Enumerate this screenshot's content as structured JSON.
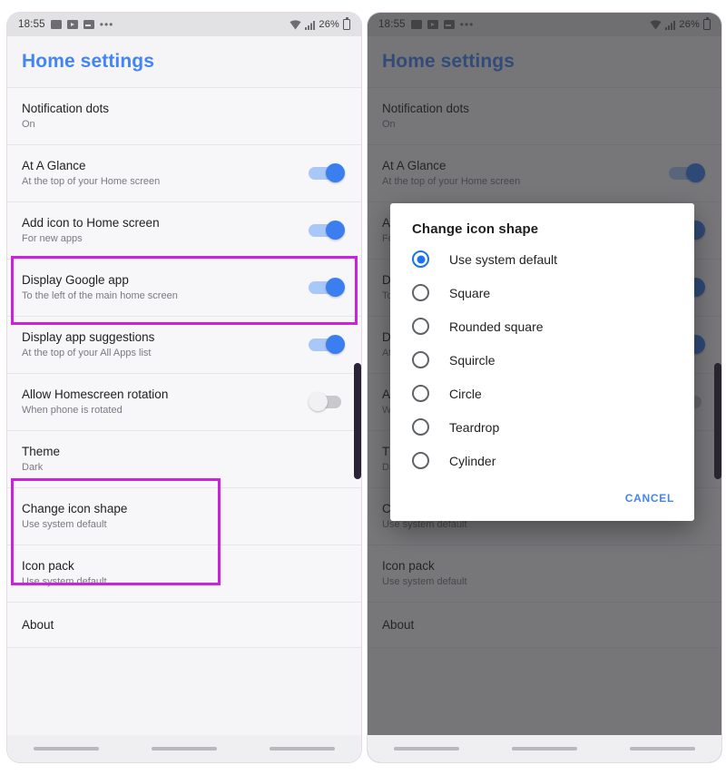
{
  "status_bar": {
    "time": "18:55",
    "battery_percent": "26%",
    "icons": [
      "photo-icon",
      "video-icon",
      "card-icon",
      "overflow-dots-icon",
      "wifi-icon",
      "signal-icon",
      "battery-icon"
    ]
  },
  "header": {
    "title": "Home settings"
  },
  "settings": [
    {
      "title": "Notification dots",
      "subtitle": "On",
      "control": "none",
      "state": ""
    },
    {
      "title": "At A Glance",
      "subtitle": "At the top of your Home screen",
      "control": "switch",
      "state": "on"
    },
    {
      "title": "Add icon to Home screen",
      "subtitle": "For new apps",
      "control": "switch",
      "state": "on"
    },
    {
      "title": "Display Google app",
      "subtitle": "To the left of the main home screen",
      "control": "switch",
      "state": "on"
    },
    {
      "title": "Display app suggestions",
      "subtitle": "At the top of your All Apps list",
      "control": "switch",
      "state": "on"
    },
    {
      "title": "Allow Homescreen rotation",
      "subtitle": "When phone is rotated",
      "control": "switch",
      "state": "off"
    },
    {
      "title": "Theme",
      "subtitle": "Dark",
      "control": "none",
      "state": ""
    },
    {
      "title": "Change icon shape",
      "subtitle": "Use system default",
      "control": "none",
      "state": ""
    },
    {
      "title": "Icon pack",
      "subtitle": "Use system default",
      "control": "none",
      "state": ""
    },
    {
      "title": "About",
      "subtitle": "",
      "control": "none",
      "state": ""
    }
  ],
  "dialog": {
    "title": "Change icon shape",
    "options": [
      {
        "label": "Use system default",
        "selected": true
      },
      {
        "label": "Square",
        "selected": false
      },
      {
        "label": "Rounded square",
        "selected": false
      },
      {
        "label": "Squircle",
        "selected": false
      },
      {
        "label": "Circle",
        "selected": false
      },
      {
        "label": "Teardrop",
        "selected": false
      },
      {
        "label": "Cylinder",
        "selected": false
      }
    ],
    "cancel_label": "CANCEL"
  },
  "colors": {
    "accent_blue": "#4285f4",
    "switch_on": "#3b7ef0",
    "highlight": "#cc21dd",
    "radio_selected": "#1a73e8"
  }
}
